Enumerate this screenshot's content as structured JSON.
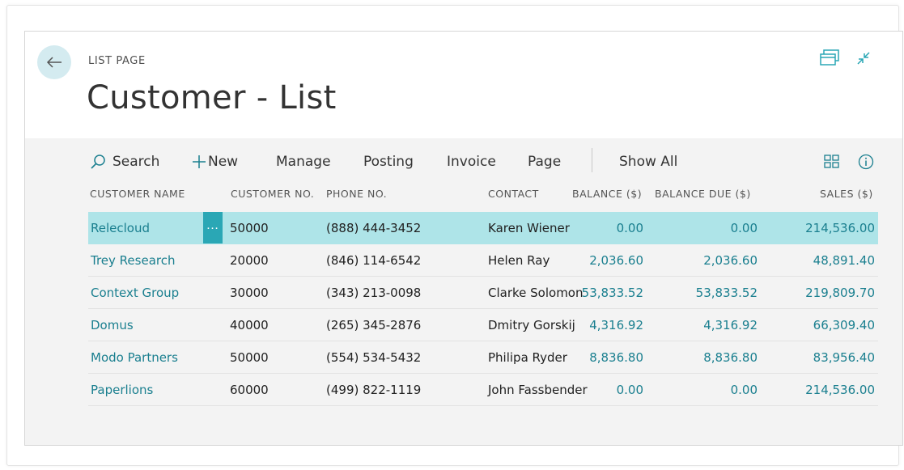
{
  "header": {
    "breadcrumb": "LIST PAGE",
    "title": "Customer - List"
  },
  "toolbar": {
    "search_label": "Search",
    "new_label": "New",
    "manage_label": "Manage",
    "posting_label": "Posting",
    "invoice_label": "Invoice",
    "page_label": "Page",
    "show_all_label": "Show All"
  },
  "table": {
    "headers": {
      "name": "CUSTOMER NAME",
      "no": "CUSTOMER NO.",
      "phone": "PHONE NO.",
      "contact": "CONTACT",
      "balance": "BALANCE ($)",
      "balance_due": "BALANCE DUE  ($)",
      "sales": "SALES ($)"
    },
    "rows": [
      {
        "name": "Relecloud",
        "no": "50000",
        "phone": "(888) 444-3452",
        "contact": "Karen Wiener",
        "balance": "0.00",
        "balance_due": "0.00",
        "sales": "214,536.00"
      },
      {
        "name": "Trey Research",
        "no": "20000",
        "phone": "(846) 114-6542",
        "contact": "Helen Ray",
        "balance": "2,036.60",
        "balance_due": "2,036.60",
        "sales": "48,891.40"
      },
      {
        "name": "Context Group",
        "no": "30000",
        "phone": "(343) 213-0098",
        "contact": "Clarke Solomon",
        "balance": "53,833.52",
        "balance_due": "53,833.52",
        "sales": "219,809.70"
      },
      {
        "name": "Domus",
        "no": "40000",
        "phone": "(265) 345-2876",
        "contact": "Dmitry Gorskij",
        "balance": "4,316.92",
        "balance_due": "4,316.92",
        "sales": "66,309.40"
      },
      {
        "name": "Modo Partners",
        "no": "50000",
        "phone": "(554) 534-5432",
        "contact": "Philipa Ryder",
        "balance": "8,836.80",
        "balance_due": "8,836.80",
        "sales": "83,956.40"
      },
      {
        "name": "Paperlions",
        "no": "60000",
        "phone": "(499) 822-1119",
        "contact": "John Fassbender",
        "balance": "0.00",
        "balance_due": "0.00",
        "sales": "214,536.00"
      }
    ],
    "selected_row_actions": "…"
  },
  "colors": {
    "accent": "#2aa7b5",
    "selected_row": "#aee4e8",
    "link": "#1a7f8f",
    "back_button_bg": "#d4ebf0"
  },
  "icons": [
    "back-arrow-icon",
    "open-in-new-window-icon",
    "collapse-icon",
    "search-icon",
    "plus-icon",
    "tile-view-icon",
    "info-icon"
  ]
}
